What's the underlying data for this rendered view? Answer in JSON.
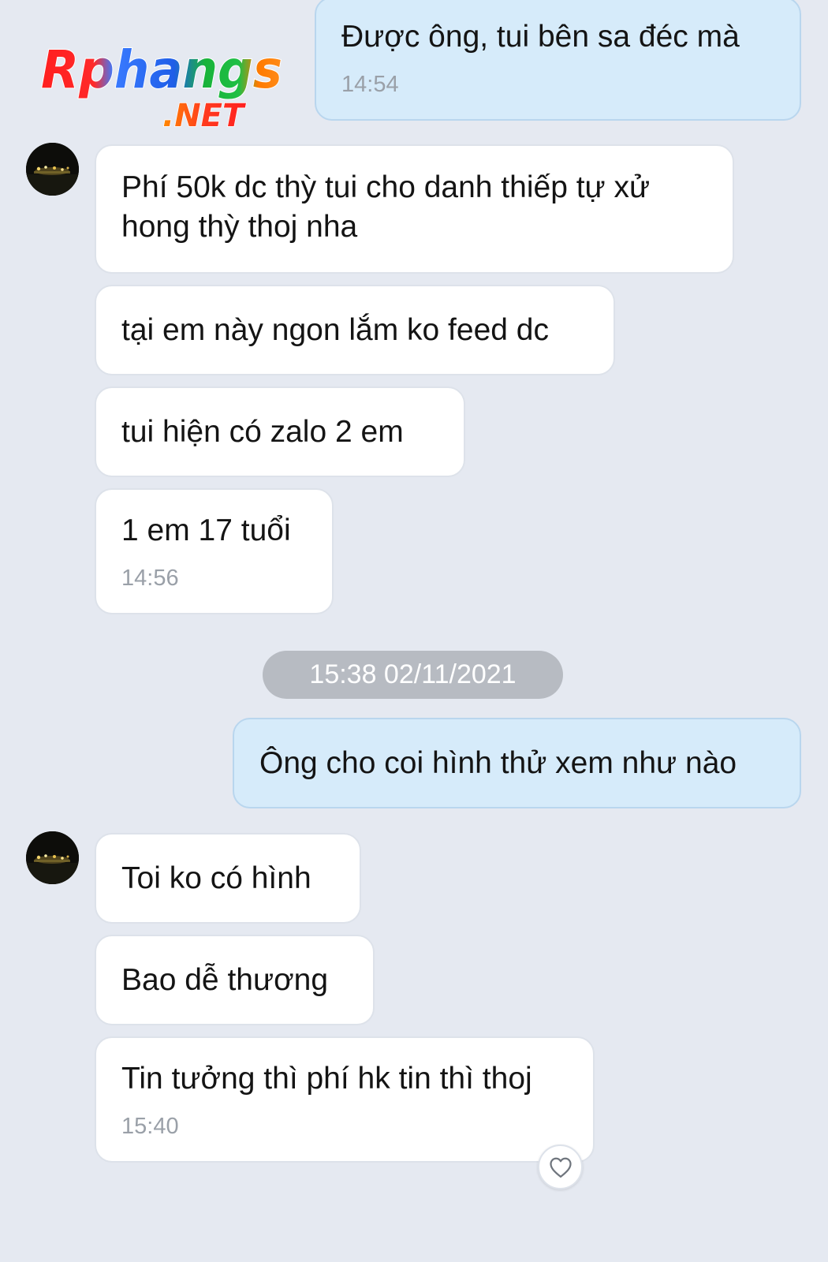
{
  "watermark": {
    "brand": "Rphangs",
    "tld": ".NET"
  },
  "messages": [
    {
      "id": "m1",
      "text": "Được ông, tui bên sa đéc mà",
      "time": "14:54"
    },
    {
      "id": "m2",
      "text": "Phí 50k dc thỳ tui cho danh thiếp tự xử hong thỳ thoj nha"
    },
    {
      "id": "m3",
      "text": "tại em này ngon lắm ko feed dc"
    },
    {
      "id": "m4",
      "text": "tui hiện có zalo 2 em"
    },
    {
      "id": "m5",
      "text": "1 em 17 tuổi",
      "time": "14:56"
    },
    {
      "id": "m6",
      "text": "Ông cho coi hình thử xem như nào"
    },
    {
      "id": "m7",
      "text": "Toi ko có hình"
    },
    {
      "id": "m8",
      "text": "Bao dễ thương"
    },
    {
      "id": "m9",
      "text": "Tin tưởng thì phí hk tin thì thoj",
      "time": "15:40"
    }
  ],
  "date_separator": "15:38 02/11/2021",
  "icons": {
    "avatar": "contact-avatar",
    "like": "heart-icon"
  },
  "colors": {
    "background": "#e5e9f1",
    "incoming_bubble": "#ffffff",
    "outgoing_bubble": "#d6ebfa",
    "timestamp": "#9aa0a8",
    "date_pill": "#b7bbc2"
  }
}
